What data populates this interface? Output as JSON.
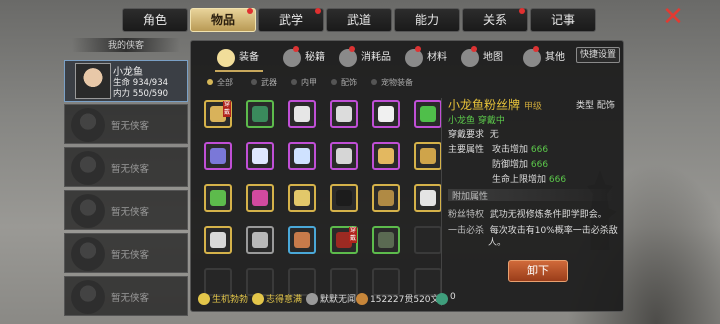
{
  "top_tabs": [
    {
      "label": "角色",
      "active": false,
      "badge": false
    },
    {
      "label": "物品",
      "active": true,
      "badge": true
    },
    {
      "label": "武学",
      "active": false,
      "badge": true
    },
    {
      "label": "武道",
      "active": false,
      "badge": false
    },
    {
      "label": "能力",
      "active": false,
      "badge": false
    },
    {
      "label": "关系",
      "active": false,
      "badge": true
    },
    {
      "label": "记事",
      "active": false,
      "badge": false
    }
  ],
  "left_panel": {
    "header": "我的侠客",
    "character": {
      "name": "小龙鱼",
      "hp_label": "生命",
      "hp": "934/934",
      "mp_label": "内力",
      "mp": "550/590"
    },
    "empty_label": "暂无侠客"
  },
  "categories": [
    {
      "label": "装备",
      "active": true,
      "badge": false
    },
    {
      "label": "秘籍",
      "active": false,
      "badge": true
    },
    {
      "label": "消耗品",
      "active": false,
      "badge": true
    },
    {
      "label": "材料",
      "active": false,
      "badge": true
    },
    {
      "label": "地图",
      "active": false,
      "badge": true
    },
    {
      "label": "其他",
      "active": false,
      "badge": true
    }
  ],
  "quick_settings": "快捷设置",
  "filters": [
    "全部",
    "武器",
    "内甲",
    "配饰",
    "宠物装备"
  ],
  "items": [
    {
      "rarity": "gold",
      "color": "#d9b25a",
      "equipped": true,
      "icon": "token-icon"
    },
    {
      "rarity": "green",
      "color": "#3a8a5c",
      "equipped": false,
      "icon": "armor-icon"
    },
    {
      "rarity": "purple",
      "color": "#e6e6e6",
      "equipped": false,
      "icon": "scroll-icon"
    },
    {
      "rarity": "purple",
      "color": "#dcdcdc",
      "equipped": false,
      "icon": "disc-icon"
    },
    {
      "rarity": "purple",
      "color": "#f0f0f0",
      "equipped": false,
      "icon": "heart-icon"
    },
    {
      "rarity": "purple",
      "color": "#4fbf4a",
      "equipped": false,
      "icon": "beast-icon"
    },
    {
      "rarity": "purple",
      "color": "#7a78d8",
      "equipped": false,
      "icon": "orb-icon"
    },
    {
      "rarity": "purple",
      "color": "#dfe8ff",
      "equipped": false,
      "icon": "pearl-icon"
    },
    {
      "rarity": "purple",
      "color": "#cfe2ff",
      "equipped": false,
      "icon": "pearl-icon"
    },
    {
      "rarity": "purple",
      "color": "#d6d6d6",
      "equipped": false,
      "icon": "leaf-icon"
    },
    {
      "rarity": "purple",
      "color": "#e3b860",
      "equipped": false,
      "icon": "box-icon"
    },
    {
      "rarity": "gold",
      "color": "#cfa44a",
      "equipped": false,
      "icon": "mask-icon"
    },
    {
      "rarity": "gold",
      "color": "#5dbb4c",
      "equipped": false,
      "icon": "rod-icon"
    },
    {
      "rarity": "gold",
      "color": "#d24aa0",
      "equipped": false,
      "icon": "whip-icon"
    },
    {
      "rarity": "gold",
      "color": "#e2c86a",
      "equipped": false,
      "icon": "book-icon"
    },
    {
      "rarity": "gold",
      "color": "#1c1c1c",
      "equipped": false,
      "icon": "ring-icon"
    },
    {
      "rarity": "gold",
      "color": "#b08a44",
      "equipped": false,
      "icon": "blade-icon"
    },
    {
      "rarity": "gold",
      "color": "#e4e4e4",
      "equipped": false,
      "icon": "gourd-icon"
    },
    {
      "rarity": "gold",
      "color": "#d8d8d8",
      "equipped": false,
      "icon": "gourd-icon"
    },
    {
      "rarity": "gray",
      "color": "#b8b8b8",
      "equipped": false,
      "icon": "sword-icon"
    },
    {
      "rarity": "blue",
      "color": "#c77a4a",
      "equipped": false,
      "icon": "fan-icon"
    },
    {
      "rarity": "green",
      "color": "#9c2a22",
      "equipped": true,
      "icon": "cloak-icon"
    },
    {
      "rarity": "green",
      "color": "#5a6a52",
      "equipped": false,
      "icon": "robe-icon"
    }
  ],
  "detail": {
    "name": "小龙鱼粉丝牌",
    "grade": "甲级",
    "type_label": "类型",
    "type_value": "配饰",
    "owner": "小龙鱼 穿戴中",
    "req_label": "穿戴要求",
    "req_value": "无",
    "main_attr_label": "主要属性",
    "attrs": [
      {
        "label": "攻击增加",
        "value": "666"
      },
      {
        "label": "防御增加",
        "value": "666"
      },
      {
        "label": "生命上限增加",
        "value": "666"
      }
    ],
    "extra_label": "附加属性",
    "special1_label": "粉丝特权",
    "special1_text": "武功无视修炼条件即学即会。",
    "special2_label": "一击必杀",
    "special2_text_1": "每次攻击有10%概率一击必杀敌",
    "special2_text_2": "人。",
    "unequip": "卸下",
    "equipped_tag": "穿戴"
  },
  "bottom_bar": [
    {
      "label": "生机勃勃",
      "color": "#e3c64a",
      "icon": "vitality-icon"
    },
    {
      "label": "志得意满",
      "color": "#e3c64a",
      "icon": "mood-icon"
    },
    {
      "label": "默默无闻",
      "color": "#e8e8e8",
      "icon": "fame-icon"
    },
    {
      "label": "152227贯520文",
      "color": "#e8e8e8",
      "icon": "coin-icon"
    },
    {
      "label": "0",
      "color": "#e8e8e8",
      "icon": "gem-icon"
    }
  ],
  "colors": {
    "accent": "#d5b24a",
    "danger": "#e23a32",
    "green_value": "#5cc94b",
    "title": "#e6c23a"
  }
}
